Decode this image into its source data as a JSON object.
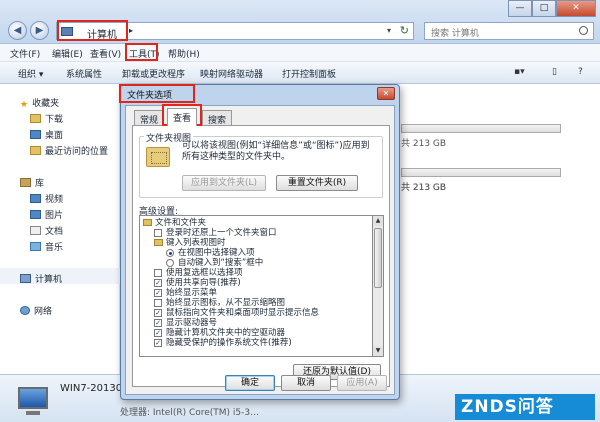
{
  "explorer": {
    "address": {
      "text": "计算机",
      "chevron": "▸"
    },
    "search_placeholder": "搜索 计算机",
    "window_buttons": {
      "minimize": "—",
      "maximize": "□",
      "close": "✕"
    },
    "menu": [
      "文件(F)",
      "编辑(E)",
      "查看(V)",
      "工具(T)",
      "帮助(H)"
    ],
    "toolbar": [
      "组织 ▾",
      "系统属性",
      "卸载或更改程序",
      "映射网络驱动器",
      "打开控制面板"
    ],
    "toolbar_icons": {
      "view": "▪▾",
      "layout": "▯",
      "help": "?"
    },
    "sidebar": {
      "favorites": "收藏夹",
      "downloads": "下载",
      "desktop": "桌面",
      "recent": "最近访问的位置",
      "libraries": "库",
      "videos": "视频",
      "pictures": "图片",
      "documents": "文档",
      "music": "音乐",
      "computer": "计算机",
      "network": "网络"
    },
    "drives": [
      "共 213 GB",
      "共 213 GB",
      "共 213 GB"
    ],
    "details": {
      "name": "WIN7-20130…",
      "cpu": "处理器: Intel(R) Core(TM) i5-3…"
    }
  },
  "dialog": {
    "title": "文件夹选项",
    "close": "✕",
    "tabs": [
      "常规",
      "查看",
      "搜索"
    ],
    "folder_views": {
      "title": "文件夹视图",
      "text": "可以将该视图(例如“详细信息”或“图标”)应用到所有这种类型的文件夹中。",
      "apply_button": "应用到文件夹(L)",
      "reset_button": "重置文件夹(R)"
    },
    "advanced_label": "高级设置:",
    "tree": [
      {
        "kind": "folder",
        "level": 0,
        "label": "文件和文件夹"
      },
      {
        "kind": "checkbox",
        "level": 1,
        "checked": false,
        "label": "登录时还原上一个文件夹窗口"
      },
      {
        "kind": "folder",
        "level": 1,
        "label": "键入列表视图时"
      },
      {
        "kind": "radio",
        "level": 2,
        "checked": true,
        "label": "在视图中选择键入项"
      },
      {
        "kind": "radio",
        "level": 2,
        "checked": false,
        "label": "自动键入到“搜索”框中"
      },
      {
        "kind": "checkbox",
        "level": 1,
        "checked": false,
        "label": "使用复选框以选择项"
      },
      {
        "kind": "checkbox",
        "level": 1,
        "checked": true,
        "label": "使用共享向导(推荐)"
      },
      {
        "kind": "checkbox",
        "level": 1,
        "checked": true,
        "label": "始终显示菜单"
      },
      {
        "kind": "checkbox",
        "level": 1,
        "checked": false,
        "label": "始终显示图标，从不显示缩略图"
      },
      {
        "kind": "checkbox",
        "level": 1,
        "checked": true,
        "label": "鼠标指向文件夹和桌面项时显示提示信息"
      },
      {
        "kind": "checkbox",
        "level": 1,
        "checked": true,
        "label": "显示驱动器号"
      },
      {
        "kind": "checkbox",
        "level": 1,
        "checked": true,
        "label": "隐藏计算机文件夹中的空驱动器"
      },
      {
        "kind": "checkbox",
        "level": 1,
        "checked": true,
        "label": "隐藏受保护的操作系统文件(推荐)"
      }
    ],
    "restore_button": "还原为默认值(D)",
    "ok_button": "确定",
    "cancel_button": "取消",
    "apply_button": "应用(A)"
  },
  "watermark": "ZNDS问答",
  "colors": {
    "highlight": "#e0251b",
    "watermark": "#168bd6"
  }
}
